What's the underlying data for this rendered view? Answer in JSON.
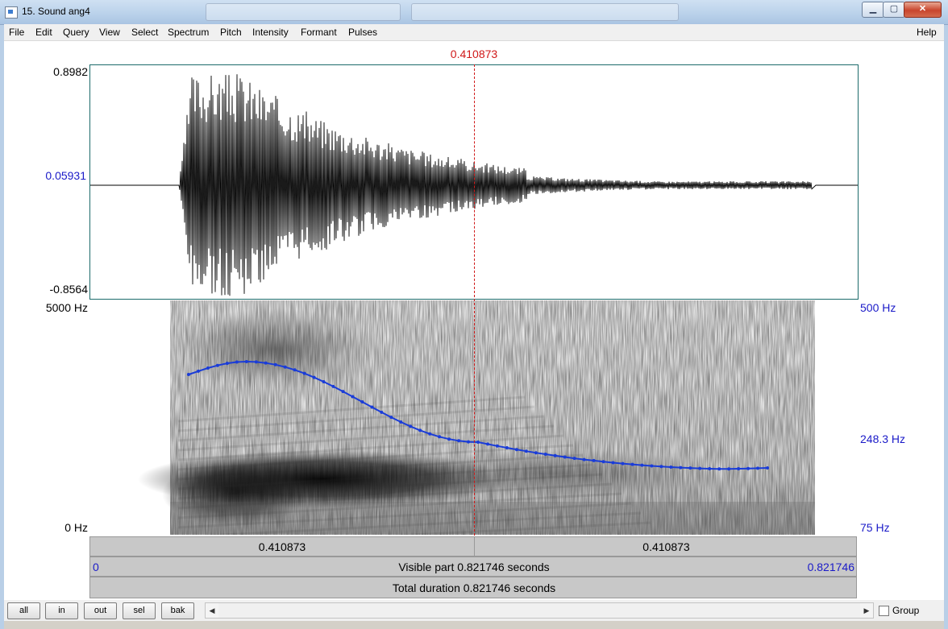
{
  "window": {
    "title": "15. Sound ang4",
    "minimize": "▁",
    "maximize": "▢",
    "close": "✕"
  },
  "menu": [
    "File",
    "Edit",
    "Query",
    "View",
    "Select",
    "Spectrum",
    "Pitch",
    "Intensity",
    "Formant",
    "Pulses"
  ],
  "help": "Help",
  "cursor": {
    "time": "0.410873"
  },
  "waveform": {
    "max_label": "0.8982",
    "cursor_value_label": "0.05931",
    "min_label": "-0.8564"
  },
  "spectrogram": {
    "freq_top": "5000 Hz",
    "freq_bottom": "0 Hz",
    "pitch_top": "500 Hz",
    "pitch_mid": "248.3 Hz",
    "pitch_bottom": "75 Hz",
    "pitch_contour_color": "#1a3cd8"
  },
  "ruler": {
    "left_half": "0.410873",
    "right_half": "0.410873",
    "visible_start": "0",
    "visible_text": "Visible part 0.821746 seconds",
    "visible_end": "0.821746",
    "total_text": "Total duration 0.821746 seconds"
  },
  "buttons": {
    "all": "all",
    "in": "in",
    "out": "out",
    "sel": "sel",
    "bak": "bak"
  },
  "group": {
    "label": "Group",
    "checked": false
  }
}
